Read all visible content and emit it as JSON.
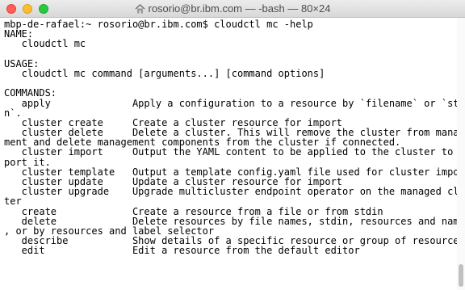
{
  "window": {
    "title": "rosorio@br.ibm.com — -bash — 80×24",
    "title_icon": "home-folder-icon",
    "traffic_lights": {
      "close": "#fe5f57",
      "minimize": "#febc2e",
      "maximize": "#28c840"
    }
  },
  "terminal": {
    "lines": [
      "mbp-de-rafael:~ rosorio@br.ibm.com$ cloudctl mc -help",
      "NAME:",
      "   cloudctl mc",
      "",
      "USAGE:",
      "   cloudctl mc command [arguments...] [command options]",
      "",
      "COMMANDS:",
      "   apply              Apply a configuration to a resource by `filename` or `stdi",
      "n`.",
      "   cluster create     Create a cluster resource for import",
      "   cluster delete     Delete a cluster. This will remove the cluster from manage",
      "ment and delete management components from the cluster if connected.",
      "   cluster import     Output the YAML content to be applied to the cluster to im",
      "port it.",
      "   cluster template   Output a template config.yaml file used for cluster import",
      "   cluster update     Update a cluster resource for import",
      "   cluster upgrade    Upgrade multicluster endpoint operator on the managed clus",
      "ter",
      "   create             Create a resource from a file or from stdin",
      "   delete             Delete resources by file names, stdin, resources and names",
      ", or by resources and label selector",
      "   describe           Show details of a specific resource or group of resources",
      "   edit               Edit a resource from the default editor"
    ]
  }
}
